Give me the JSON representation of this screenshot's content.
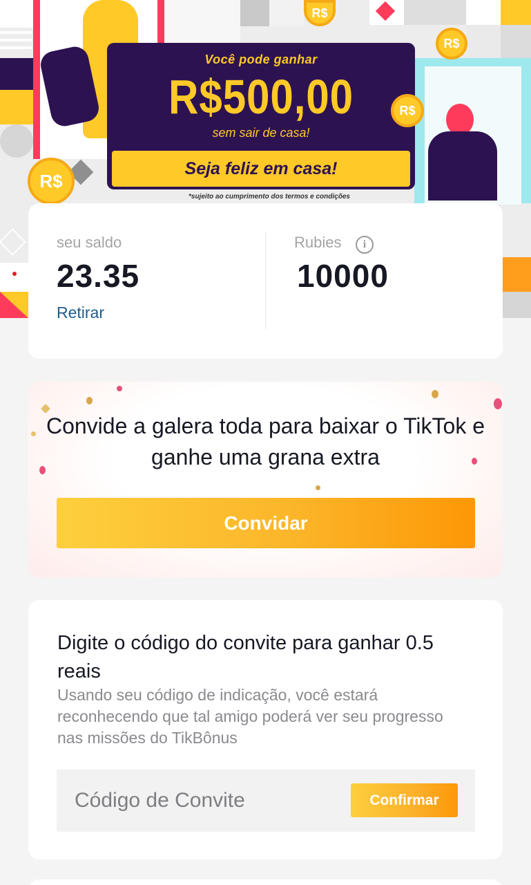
{
  "banner": {
    "headline_top": "Você pode ganhar",
    "amount": "R$500,00",
    "headline_bottom": "sem sair de casa!",
    "slogan": "Seja feliz em casa!",
    "disclaimer": "*sujeito ao cumprimento dos termos e condições",
    "coin_label": "R$",
    "colors": {
      "board": "#2d1252",
      "accent": "#ffc928"
    }
  },
  "balance": {
    "label": "seu saldo",
    "value": "23.35",
    "withdraw_label": "Retirar"
  },
  "rubies": {
    "label": "Rubies",
    "value": "10000",
    "info_icon": "info-icon"
  },
  "invite": {
    "text": "Convide a galera toda para baixar o TikTok e ganhe uma grana extra",
    "button_label": "Convidar"
  },
  "invite_code": {
    "title": "Digite o código do convite para ganhar 0.5 reais",
    "description": "Usando seu código de indicação, você estará reconhecendo que tal amigo poderá ver seu progresso nas missões do TikBônus",
    "input_placeholder": "Código de Convite",
    "input_value": "",
    "confirm_label": "Confirmar"
  },
  "colors": {
    "button_gradient_start": "#fdcf3e",
    "button_gradient_end": "#fd9807",
    "link": "#1f5d8a",
    "text_primary": "#161823",
    "text_secondary": "#8a8a8f"
  }
}
